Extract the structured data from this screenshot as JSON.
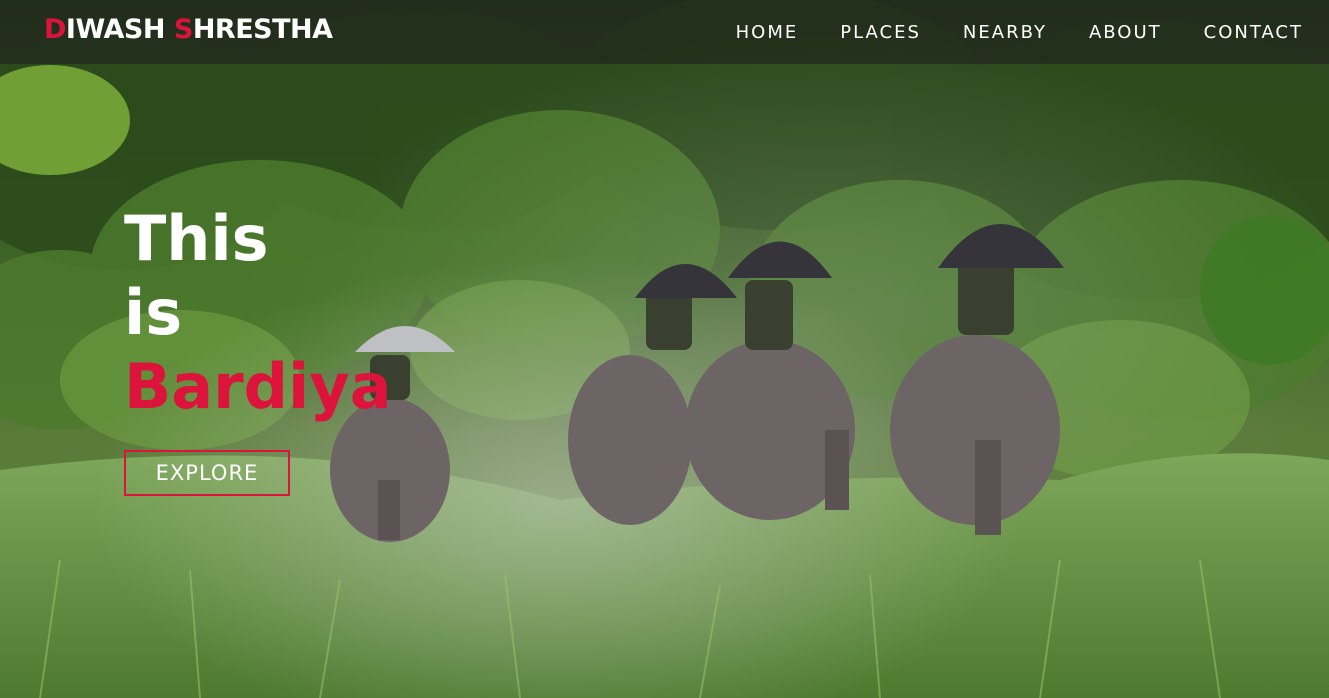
{
  "header": {
    "logo_first_initial": "D",
    "logo_first_rest": "IWASH ",
    "logo_last_initial": "S",
    "logo_last_rest": "HRESTHA"
  },
  "nav": {
    "items": [
      {
        "label": "HOME"
      },
      {
        "label": "PLACES"
      },
      {
        "label": "NEARBY"
      },
      {
        "label": "ABOUT"
      },
      {
        "label": "CONTACT"
      }
    ]
  },
  "hero": {
    "line1": "This",
    "line2": "is",
    "line3": "Bardiya",
    "cta_label": "EXPLORE",
    "background_image": "elephant-safari-in-jungle-grassland"
  },
  "colors": {
    "accent": "#dc143c",
    "text": "#ffffff",
    "navbar_bg": "rgba(30,30,30,0.55)"
  }
}
